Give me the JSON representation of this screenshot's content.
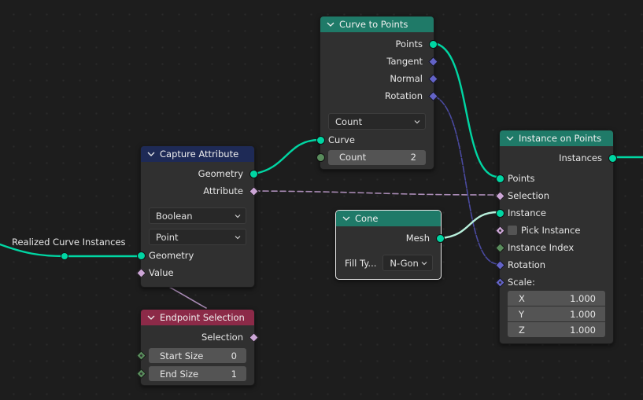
{
  "colors": {
    "geometry": "#00d6a3",
    "vector": "#6363c7",
    "boolean": "#cca6d6",
    "integer": "#598c5c",
    "link_cone": "#b8f0dc",
    "header_geometry": "#1f7a68",
    "header_attribute": "#1e2a56",
    "header_input": "#8c2a48"
  },
  "reroute": {
    "label": "Realized Curve Instances"
  },
  "curve_to_points": {
    "title": "Curve to Points",
    "outputs": [
      "Points",
      "Tangent",
      "Normal",
      "Rotation"
    ],
    "mode": "Count",
    "input_curve": "Curve",
    "count_label": "Count",
    "count_value": "2"
  },
  "capture_attribute": {
    "title": "Capture Attribute",
    "outputs": [
      "Geometry",
      "Attribute"
    ],
    "data_type": "Boolean",
    "domain": "Point",
    "inputs": [
      "Geometry",
      "Value"
    ]
  },
  "cone": {
    "title": "Cone",
    "output": "Mesh",
    "fill_label": "Fill Ty...",
    "fill_value": "N-Gon"
  },
  "instance_on_points": {
    "title": "Instance on Points",
    "output": "Instances",
    "inputs": [
      "Points",
      "Selection",
      "Instance",
      "Pick Instance",
      "Instance Index",
      "Rotation",
      "Scale:"
    ],
    "pick_instance_checked": false,
    "scale": [
      {
        "axis": "X",
        "value": "1.000"
      },
      {
        "axis": "Y",
        "value": "1.000"
      },
      {
        "axis": "Z",
        "value": "1.000"
      }
    ]
  },
  "endpoint_selection": {
    "title": "Endpoint Selection",
    "output": "Selection",
    "start_label": "Start Size",
    "start_value": "0",
    "end_label": "End Size",
    "end_value": "1"
  }
}
